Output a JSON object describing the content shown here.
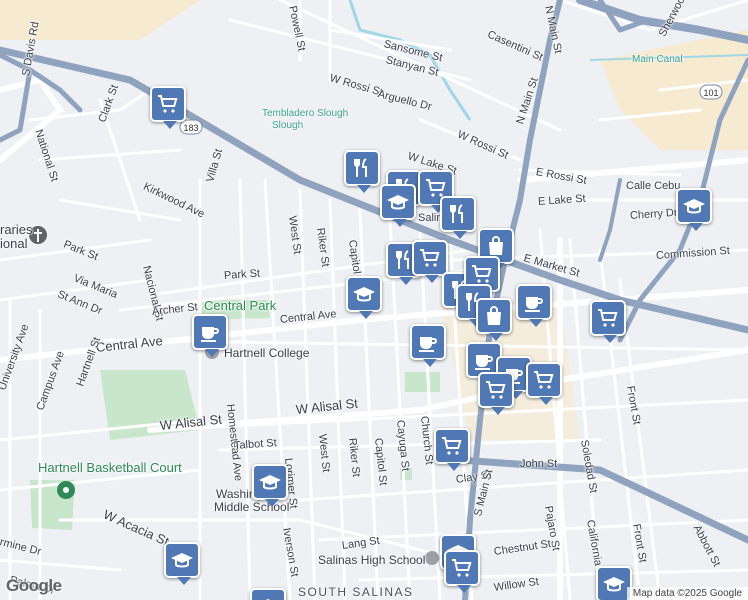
{
  "map": {
    "attribution": "Map data ©2025 Google",
    "logo": "Google",
    "colors": {
      "background": "#eef0f4",
      "highway": "#8fa3bf",
      "park": "#c8e6cc",
      "marker": "#4f78b5",
      "commercial": "#f6ebd1"
    },
    "route_shield": [
      "183",
      "101"
    ],
    "labels": {
      "sansome_st": "Sansome St",
      "stanyan_st": "Stanyan St",
      "casentini_st": "Casentini St",
      "n_main_st_top": "N Main St",
      "sherwood": "Sherwood",
      "powell_st": "Powell St",
      "w_rossi_st_top": "W Rossi St",
      "arguello_dr": "Arguello Dr",
      "main_canal": "Main Canal",
      "s_davis_rd": "S Davis Rd",
      "clark_st": "Clark St",
      "national_st": "National St",
      "tembladero_slough": "Tembladero Slough",
      "w_rossi_st": "W Rossi St",
      "n_main_st": "N Main St",
      "w_lake_st": "W Lake St",
      "e_rossi_st": "E Rossi St",
      "calle_cebu": "Calle Cebu",
      "e_lake_st": "E Lake St",
      "cherry_dr": "Cherry Dr",
      "kirkwood_ave": "Kirkwood Ave",
      "villa_st": "Villa St",
      "west_st": "West St",
      "riker_st": "Riker St",
      "capitol_st": "Capitol St",
      "salinas_partial": "Salin",
      "e_market_st": "E Market St",
      "commission_st": "Commission St",
      "library_partial_1": "raries",
      "library_partial_2": "ional",
      "park_st_left": "Park St",
      "via_maria": "Via Maria",
      "nacional_st": "Nacional St",
      "st_ann_dr": "St Ann Dr",
      "park_st": "Park St",
      "archer_st": "Archer St",
      "central_park": "Central Park",
      "central_ave_right": "Central Ave",
      "central_ave_left": "Central Ave",
      "hartnell_college": "Hartnell College",
      "homestead_ave": "Homestead Ave",
      "university_ave": "University Ave",
      "campus_ave": "Campus Ave",
      "hartnell_st": "Hartnell St",
      "w_alisal_st": "W Alisal St",
      "talbot_st": "Talbot St",
      "lorimer_st": "Lorimer St",
      "west_st_lower": "West St",
      "riker_st_lower": "Riker St",
      "capitol_st_lower": "Capitol St",
      "cayuga_st": "Cayuga St",
      "church_st": "Church St",
      "st_partial": "St",
      "ey_st_partial": "ey St",
      "st_partial_2": "St",
      "front_st": "Front St",
      "soledad_st": "Soledad St",
      "john_st": "John St",
      "clay_st": "Clay St",
      "hartnell_basketball_court": "Hartnell Basketball Court",
      "washington_partial": "Washingto",
      "middle_school": "Middle School",
      "w_acacia_st": "W Acacia St",
      "iverson_st": "Iverson St",
      "s_main_st": "S Main St",
      "pajaro_st": "Pajaro St",
      "california_st": "California St",
      "front_st_lower": "Front St",
      "abbott_st": "Abbott St",
      "d_partial": "d",
      "lang_st": "Lang St",
      "rmine_dr": "rmine Dr",
      "chestnut_st": "Chestnut St",
      "salinas_high_school": "Salinas High School",
      "palma_dr": "Palma Dr",
      "willow_st": "Willow St",
      "south_salinas": "SOUTH SALINAS"
    },
    "markers": [
      {
        "name": "grocery-1",
        "icon": "shopping-cart-icon"
      },
      {
        "name": "restaurant-1",
        "icon": "fork-knife-icon"
      },
      {
        "name": "restaurant-2",
        "icon": "fork-knife-icon"
      },
      {
        "name": "grocery-2",
        "icon": "shopping-cart-icon"
      },
      {
        "name": "school-1",
        "icon": "graduation-cap-icon"
      },
      {
        "name": "restaurant-3",
        "icon": "fork-knife-icon"
      },
      {
        "name": "restaurant-4",
        "icon": "fork-knife-icon"
      },
      {
        "name": "shopping-1",
        "icon": "shopping-bag-icon"
      },
      {
        "name": "school-2",
        "icon": "graduation-cap-icon"
      },
      {
        "name": "restaurant-5",
        "icon": "fork-knife-icon"
      },
      {
        "name": "grocery-3",
        "icon": "shopping-cart-icon"
      },
      {
        "name": "school-3",
        "icon": "graduation-cap-icon"
      },
      {
        "name": "restaurant-6",
        "icon": "fork-knife-icon"
      },
      {
        "name": "restaurant-7",
        "icon": "fork-knife-icon"
      },
      {
        "name": "grocery-4",
        "icon": "shopping-cart-icon"
      },
      {
        "name": "coffee-1",
        "icon": "coffee-cup-icon"
      },
      {
        "name": "shopping-2",
        "icon": "shopping-bag-icon"
      },
      {
        "name": "grocery-5",
        "icon": "shopping-cart-icon"
      },
      {
        "name": "coffee-2",
        "icon": "coffee-cup-icon"
      },
      {
        "name": "coffee-3",
        "icon": "coffee-cup-icon"
      },
      {
        "name": "coffee-4",
        "icon": "coffee-cup-icon"
      },
      {
        "name": "coffee-5",
        "icon": "coffee-cup-icon"
      },
      {
        "name": "grocery-6",
        "icon": "shopping-cart-icon"
      },
      {
        "name": "grocery-7",
        "icon": "shopping-cart-icon"
      },
      {
        "name": "grocery-8",
        "icon": "shopping-cart-icon"
      },
      {
        "name": "school-4",
        "icon": "graduation-cap-icon"
      },
      {
        "name": "school-5",
        "icon": "graduation-cap-icon"
      },
      {
        "name": "school-6",
        "icon": "graduation-cap-icon"
      },
      {
        "name": "restaurant-8",
        "icon": "fork-knife-icon"
      },
      {
        "name": "grocery-9",
        "icon": "shopping-cart-icon"
      },
      {
        "name": "school-7",
        "icon": "graduation-cap-icon"
      },
      {
        "name": "school-8",
        "icon": "graduation-cap-icon"
      }
    ]
  }
}
